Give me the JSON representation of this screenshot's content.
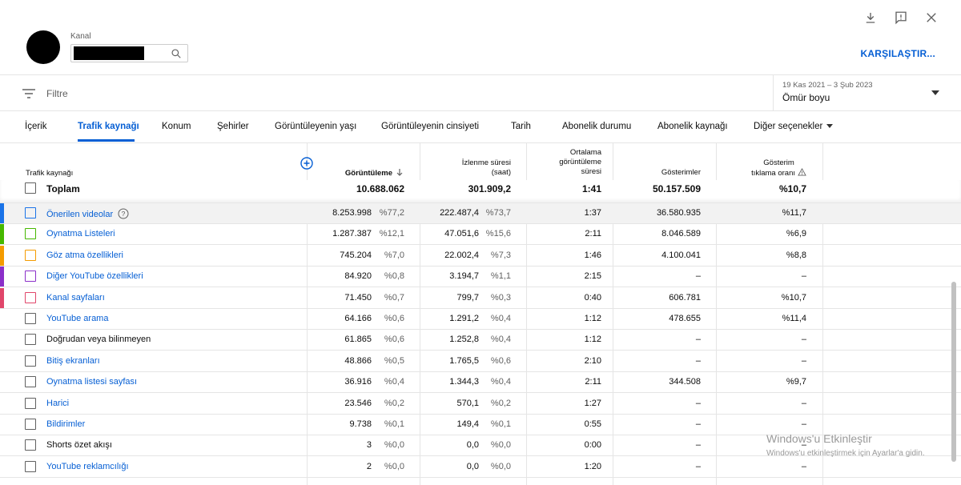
{
  "header": {
    "channel_label": "Kanal",
    "compare_label": "KARŞILAŞTIR..."
  },
  "filter": {
    "placeholder": "Filtre",
    "date_range": "19 Kas 2021 – 3 Şub 2023",
    "period": "Ömür boyu"
  },
  "tabs": [
    {
      "label": "İçerik"
    },
    {
      "label": "Trafik kaynağı"
    },
    {
      "label": "Konum"
    },
    {
      "label": "Şehirler"
    },
    {
      "label": "Görüntüleyenin yaşı"
    },
    {
      "label": "Görüntüleyenin cinsiyeti"
    },
    {
      "label": "Tarih"
    },
    {
      "label": "Abonelik durumu"
    },
    {
      "label": "Abonelik kaynağı"
    },
    {
      "label": "Diğer seçenekler"
    }
  ],
  "columns": {
    "source": "Trafik kaynağı",
    "views": "Görüntüleme",
    "watch_1": "İzlenme süresi",
    "watch_2": "(saat)",
    "avg_1": "Ortalama",
    "avg_2": "görüntüleme",
    "avg_3": "süresi",
    "impressions": "Gösterimler",
    "ctr_1": "Gösterim",
    "ctr_2": "tıklama oranı"
  },
  "total": {
    "label": "Toplam",
    "views": "10.688.062",
    "watch": "301.909,2",
    "avg": "1:41",
    "impressions": "50.157.509",
    "ctr": "%10,7"
  },
  "rows": [
    {
      "source": "Önerilen videolar",
      "views": "8.253.998",
      "views_pct": "%77,2",
      "watch": "222.487,4",
      "watch_pct": "%73,7",
      "avg": "1:37",
      "impressions": "36.580.935",
      "ctr": "%11,7"
    },
    {
      "source": "Oynatma Listeleri",
      "views": "1.287.387",
      "views_pct": "%12,1",
      "watch": "47.051,6",
      "watch_pct": "%15,6",
      "avg": "2:11",
      "impressions": "8.046.589",
      "ctr": "%6,9"
    },
    {
      "source": "Göz atma özellikleri",
      "views": "745.204",
      "views_pct": "%7,0",
      "watch": "22.002,4",
      "watch_pct": "%7,3",
      "avg": "1:46",
      "impressions": "4.100.041",
      "ctr": "%8,8"
    },
    {
      "source": "Diğer YouTube özellikleri",
      "views": "84.920",
      "views_pct": "%0,8",
      "watch": "3.194,7",
      "watch_pct": "%1,1",
      "avg": "2:15",
      "impressions": "–",
      "ctr": "–"
    },
    {
      "source": "Kanal sayfaları",
      "views": "71.450",
      "views_pct": "%0,7",
      "watch": "799,7",
      "watch_pct": "%0,3",
      "avg": "0:40",
      "impressions": "606.781",
      "ctr": "%10,7"
    },
    {
      "source": "YouTube arama",
      "views": "64.166",
      "views_pct": "%0,6",
      "watch": "1.291,2",
      "watch_pct": "%0,4",
      "avg": "1:12",
      "impressions": "478.655",
      "ctr": "%11,4"
    },
    {
      "source": "Doğrudan veya bilinmeyen",
      "views": "61.865",
      "views_pct": "%0,6",
      "watch": "1.252,8",
      "watch_pct": "%0,4",
      "avg": "1:12",
      "impressions": "–",
      "ctr": "–"
    },
    {
      "source": "Bitiş ekranları",
      "views": "48.866",
      "views_pct": "%0,5",
      "watch": "1.765,5",
      "watch_pct": "%0,6",
      "avg": "2:10",
      "impressions": "–",
      "ctr": "–"
    },
    {
      "source": "Oynatma listesi sayfası",
      "views": "36.916",
      "views_pct": "%0,4",
      "watch": "1.344,3",
      "watch_pct": "%0,4",
      "avg": "2:11",
      "impressions": "344.508",
      "ctr": "%9,7"
    },
    {
      "source": "Harici",
      "views": "23.546",
      "views_pct": "%0,2",
      "watch": "570,1",
      "watch_pct": "%0,2",
      "avg": "1:27",
      "impressions": "–",
      "ctr": "–"
    },
    {
      "source": "Bildirimler",
      "views": "9.738",
      "views_pct": "%0,1",
      "watch": "149,4",
      "watch_pct": "%0,1",
      "avg": "0:55",
      "impressions": "–",
      "ctr": "–"
    },
    {
      "source": "Shorts özet akışı",
      "views": "3",
      "views_pct": "%0,0",
      "watch": "0,0",
      "watch_pct": "%0,0",
      "avg": "0:00",
      "impressions": "–",
      "ctr": "–"
    },
    {
      "source": "YouTube reklamcılığı",
      "views": "2",
      "views_pct": "%0,0",
      "watch": "0,0",
      "watch_pct": "%0,0",
      "avg": "1:20",
      "impressions": "–",
      "ctr": "–"
    }
  ],
  "colors": {
    "accent": "#065fd4",
    "series": [
      "#1a73e8",
      "#46b800",
      "#f49b00",
      "#8b2fc9",
      "#e0466a"
    ]
  },
  "watermark": {
    "title": "Windows'u Etkinleştir",
    "subtitle": "Windows'u etkinleştirmek için Ayarlar'a gidin."
  }
}
